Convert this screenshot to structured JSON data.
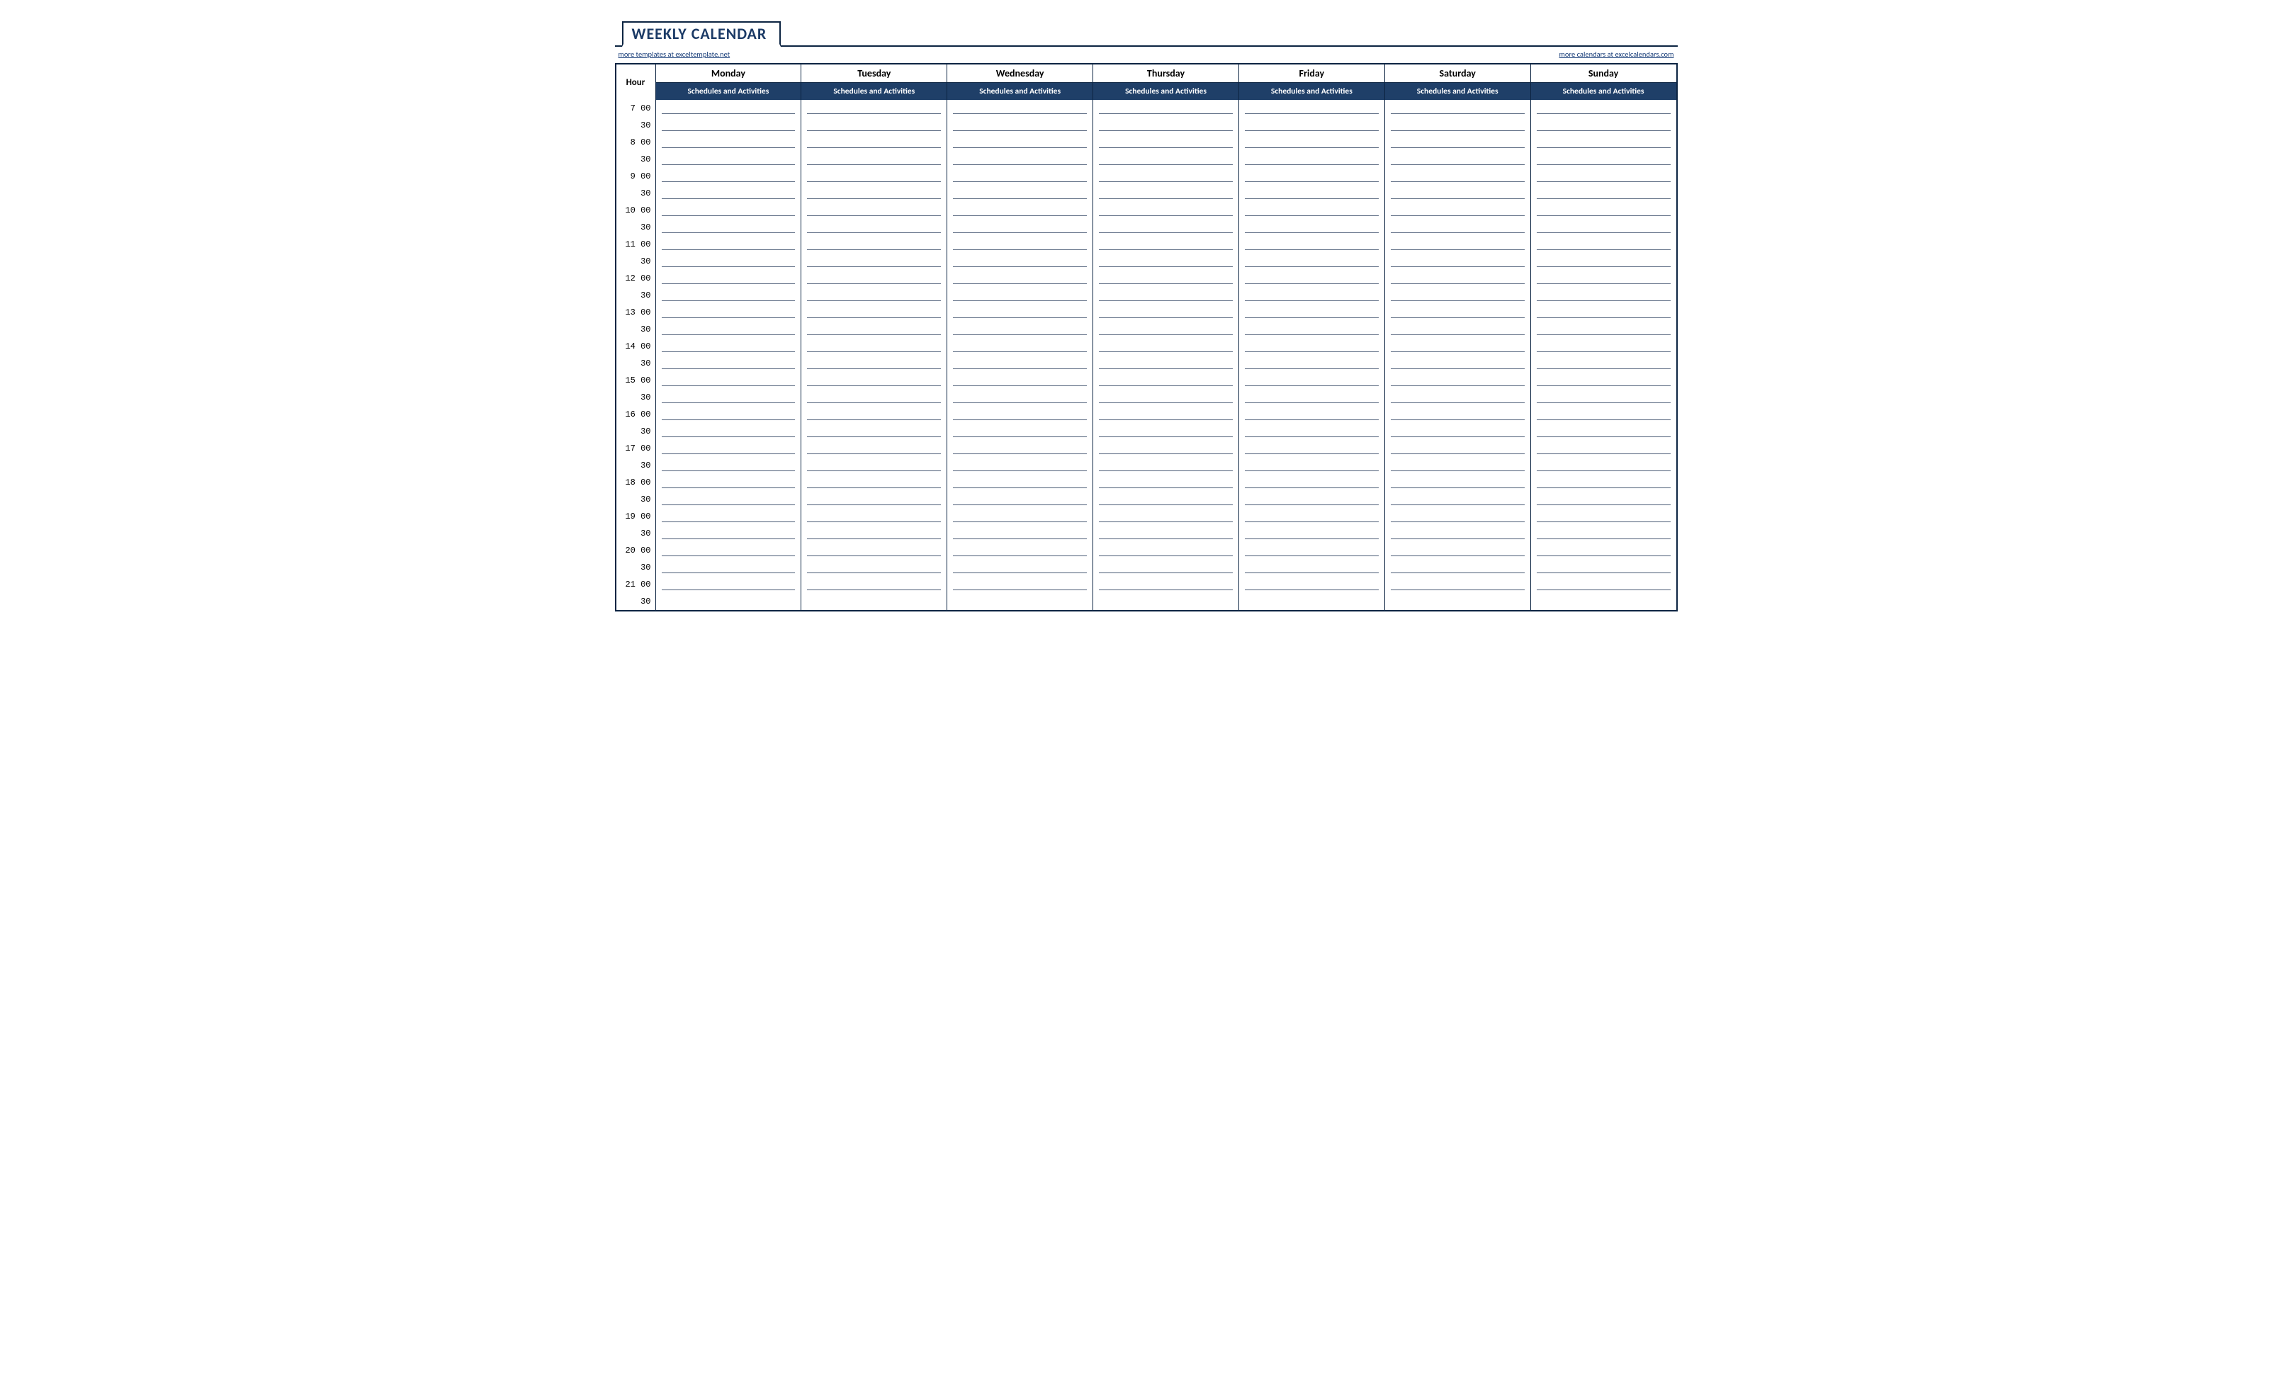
{
  "title": "WEEKLY CALENDAR",
  "links": {
    "left": "more templates at exceltemplate.net ",
    "right": "more calendars at excelcalendars.com "
  },
  "hour_label": "Hour",
  "subheading": "Schedules and Activities",
  "days": [
    "Monday",
    "Tuesday",
    "Wednesday",
    "Thursday",
    "Friday",
    "Saturday",
    "Sunday"
  ],
  "time_slots": [
    " 7 00",
    "   30",
    " 8 00",
    "   30",
    " 9 00",
    "   30",
    "10 00",
    "   30",
    "11 00",
    "   30",
    "12 00",
    "   30",
    "13 00",
    "   30",
    "14 00",
    "   30",
    "15 00",
    "   30",
    "16 00",
    "   30",
    "17 00",
    "   30",
    "18 00",
    "   30",
    "19 00",
    "   30",
    "20 00",
    "   30",
    "21 00",
    "   30"
  ]
}
